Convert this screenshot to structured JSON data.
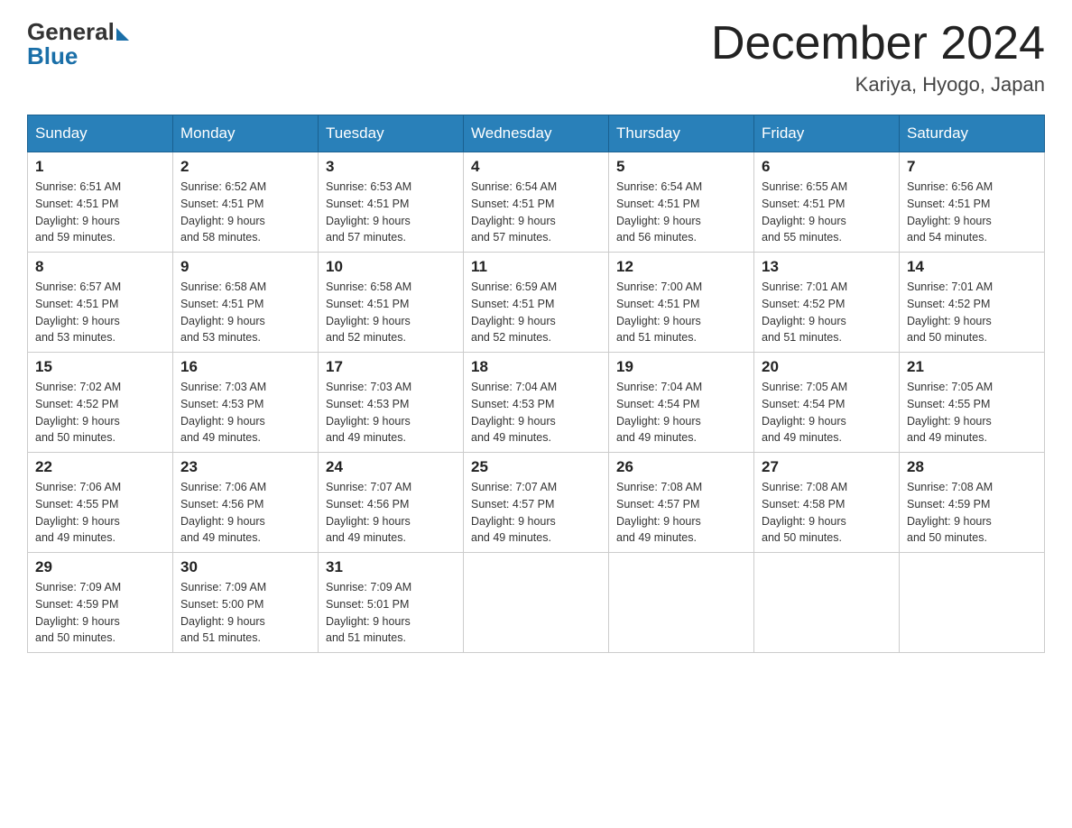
{
  "header": {
    "logo_general": "General",
    "logo_blue": "Blue",
    "month_title": "December 2024",
    "location": "Kariya, Hyogo, Japan"
  },
  "days_of_week": [
    "Sunday",
    "Monday",
    "Tuesday",
    "Wednesday",
    "Thursday",
    "Friday",
    "Saturday"
  ],
  "weeks": [
    [
      {
        "day": "1",
        "sunrise": "6:51 AM",
        "sunset": "4:51 PM",
        "daylight": "9 hours and 59 minutes."
      },
      {
        "day": "2",
        "sunrise": "6:52 AM",
        "sunset": "4:51 PM",
        "daylight": "9 hours and 58 minutes."
      },
      {
        "day": "3",
        "sunrise": "6:53 AM",
        "sunset": "4:51 PM",
        "daylight": "9 hours and 57 minutes."
      },
      {
        "day": "4",
        "sunrise": "6:54 AM",
        "sunset": "4:51 PM",
        "daylight": "9 hours and 57 minutes."
      },
      {
        "day": "5",
        "sunrise": "6:54 AM",
        "sunset": "4:51 PM",
        "daylight": "9 hours and 56 minutes."
      },
      {
        "day": "6",
        "sunrise": "6:55 AM",
        "sunset": "4:51 PM",
        "daylight": "9 hours and 55 minutes."
      },
      {
        "day": "7",
        "sunrise": "6:56 AM",
        "sunset": "4:51 PM",
        "daylight": "9 hours and 54 minutes."
      }
    ],
    [
      {
        "day": "8",
        "sunrise": "6:57 AM",
        "sunset": "4:51 PM",
        "daylight": "9 hours and 53 minutes."
      },
      {
        "day": "9",
        "sunrise": "6:58 AM",
        "sunset": "4:51 PM",
        "daylight": "9 hours and 53 minutes."
      },
      {
        "day": "10",
        "sunrise": "6:58 AM",
        "sunset": "4:51 PM",
        "daylight": "9 hours and 52 minutes."
      },
      {
        "day": "11",
        "sunrise": "6:59 AM",
        "sunset": "4:51 PM",
        "daylight": "9 hours and 52 minutes."
      },
      {
        "day": "12",
        "sunrise": "7:00 AM",
        "sunset": "4:51 PM",
        "daylight": "9 hours and 51 minutes."
      },
      {
        "day": "13",
        "sunrise": "7:01 AM",
        "sunset": "4:52 PM",
        "daylight": "9 hours and 51 minutes."
      },
      {
        "day": "14",
        "sunrise": "7:01 AM",
        "sunset": "4:52 PM",
        "daylight": "9 hours and 50 minutes."
      }
    ],
    [
      {
        "day": "15",
        "sunrise": "7:02 AM",
        "sunset": "4:52 PM",
        "daylight": "9 hours and 50 minutes."
      },
      {
        "day": "16",
        "sunrise": "7:03 AM",
        "sunset": "4:53 PM",
        "daylight": "9 hours and 49 minutes."
      },
      {
        "day": "17",
        "sunrise": "7:03 AM",
        "sunset": "4:53 PM",
        "daylight": "9 hours and 49 minutes."
      },
      {
        "day": "18",
        "sunrise": "7:04 AM",
        "sunset": "4:53 PM",
        "daylight": "9 hours and 49 minutes."
      },
      {
        "day": "19",
        "sunrise": "7:04 AM",
        "sunset": "4:54 PM",
        "daylight": "9 hours and 49 minutes."
      },
      {
        "day": "20",
        "sunrise": "7:05 AM",
        "sunset": "4:54 PM",
        "daylight": "9 hours and 49 minutes."
      },
      {
        "day": "21",
        "sunrise": "7:05 AM",
        "sunset": "4:55 PM",
        "daylight": "9 hours and 49 minutes."
      }
    ],
    [
      {
        "day": "22",
        "sunrise": "7:06 AM",
        "sunset": "4:55 PM",
        "daylight": "9 hours and 49 minutes."
      },
      {
        "day": "23",
        "sunrise": "7:06 AM",
        "sunset": "4:56 PM",
        "daylight": "9 hours and 49 minutes."
      },
      {
        "day": "24",
        "sunrise": "7:07 AM",
        "sunset": "4:56 PM",
        "daylight": "9 hours and 49 minutes."
      },
      {
        "day": "25",
        "sunrise": "7:07 AM",
        "sunset": "4:57 PM",
        "daylight": "9 hours and 49 minutes."
      },
      {
        "day": "26",
        "sunrise": "7:08 AM",
        "sunset": "4:57 PM",
        "daylight": "9 hours and 49 minutes."
      },
      {
        "day": "27",
        "sunrise": "7:08 AM",
        "sunset": "4:58 PM",
        "daylight": "9 hours and 50 minutes."
      },
      {
        "day": "28",
        "sunrise": "7:08 AM",
        "sunset": "4:59 PM",
        "daylight": "9 hours and 50 minutes."
      }
    ],
    [
      {
        "day": "29",
        "sunrise": "7:09 AM",
        "sunset": "4:59 PM",
        "daylight": "9 hours and 50 minutes."
      },
      {
        "day": "30",
        "sunrise": "7:09 AM",
        "sunset": "5:00 PM",
        "daylight": "9 hours and 51 minutes."
      },
      {
        "day": "31",
        "sunrise": "7:09 AM",
        "sunset": "5:01 PM",
        "daylight": "9 hours and 51 minutes."
      },
      null,
      null,
      null,
      null
    ]
  ],
  "labels": {
    "sunrise": "Sunrise:",
    "sunset": "Sunset:",
    "daylight": "Daylight:"
  }
}
